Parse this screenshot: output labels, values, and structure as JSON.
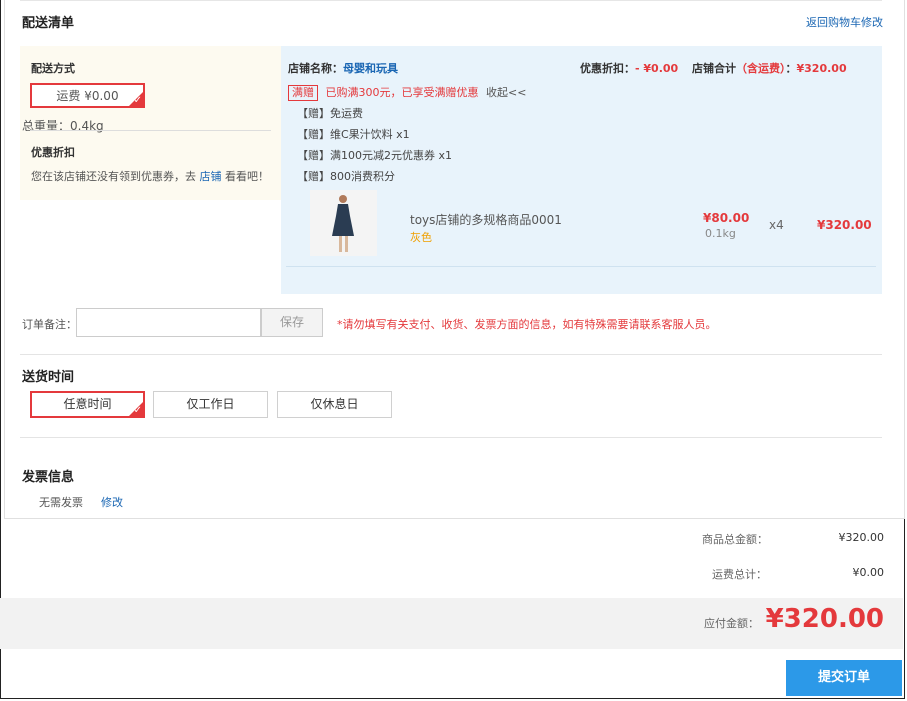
{
  "header": {
    "title": "配送清单",
    "back_link": "返回购物车修改"
  },
  "shipping": {
    "section_label": "配送方式",
    "method": "运费 ¥0.00",
    "weight": "总重量：0.4kg",
    "discount_label": "优惠折扣",
    "coupon_text_prefix": "您在该店铺还没有领到优惠券，去",
    "coupon_link": "店铺",
    "coupon_text_suffix": "看看吧！"
  },
  "store": {
    "name_label": "店铺名称：",
    "name": "母婴和玩具",
    "discount_label": "优惠折扣：",
    "discount_value": "- ¥0.00",
    "total_label": "店铺合计",
    "total_paren": "（含运费）",
    "total_sep": "：",
    "total_value": "¥320.00",
    "promo_tag": "满赠",
    "promo_text": "已购满300元，已享受满赠优惠",
    "collapse": "收起<<",
    "gifts": [
      "【赠】免运费",
      "【赠】维C果汁饮料 x1",
      "【赠】满100元减2元优惠券 x1",
      "【赠】800消费积分"
    ]
  },
  "product": {
    "name": "toys店铺的多规格商品0001",
    "spec": "灰色",
    "price": "¥80.00",
    "weight": "0.1kg",
    "qty": "x4",
    "subtotal": "¥320.00"
  },
  "note": {
    "label": "订单备注：",
    "placeholder": "",
    "save": "保存",
    "warning": "*请勿填写有关支付、收货、发票方面的信息，如有特殊需要请联系客服人员。"
  },
  "delivery": {
    "title": "送货时间",
    "options": [
      "任意时间",
      "仅工作日",
      "仅休息日"
    ]
  },
  "invoice": {
    "title": "发票信息",
    "value": "无需发票",
    "edit": "修改"
  },
  "summary": {
    "goods_label": "商品总金额：",
    "goods_value": "¥320.00",
    "shipping_label": "运费总计：",
    "shipping_value": "¥0.00",
    "payable_label": "应付金额：",
    "payable_value": "¥320.00"
  },
  "submit": "提交订单",
  "colors": {
    "accent": "#e4393c",
    "link": "#1a66b3",
    "button": "#2c99e8"
  }
}
